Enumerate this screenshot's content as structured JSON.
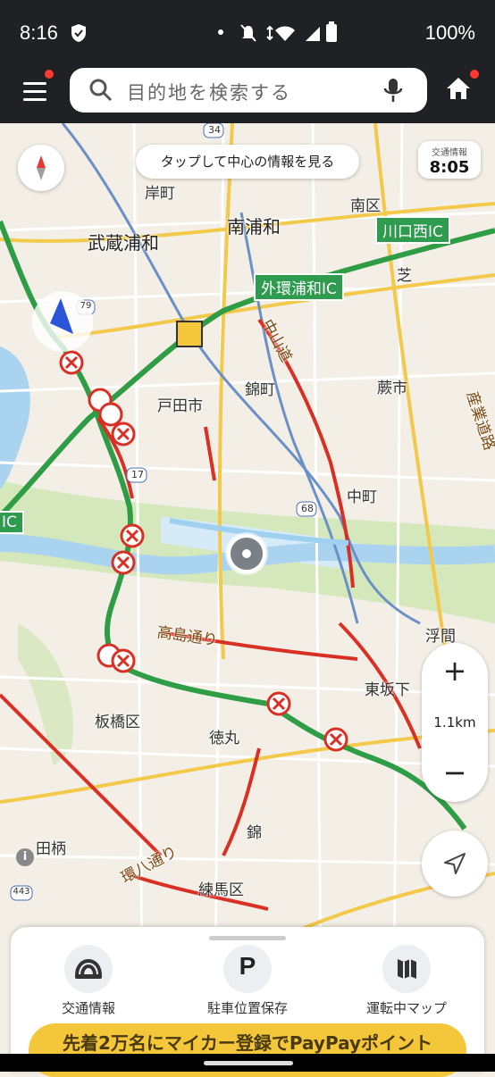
{
  "status_bar": {
    "time": "8:16",
    "battery": "100%"
  },
  "search": {
    "placeholder": "目的地を検索する"
  },
  "map": {
    "center_info_label": "タップして中心の情報を見る",
    "traffic_info": {
      "label": "交通情報",
      "time": "8:05"
    },
    "zoom": {
      "plus": "+",
      "minus": "−",
      "scale": "1.1km"
    },
    "labels": [
      "岸町",
      "武蔵浦和",
      "南浦和",
      "南区",
      "戸田市",
      "錦町",
      "蕨市",
      "中町",
      "浮間",
      "東坂下",
      "板橋区",
      "徳丸",
      "錦",
      "練馬区",
      "田柄",
      "高島通り",
      "環八通り",
      "中山道",
      "芝",
      "産業道路"
    ],
    "ic_labels": [
      "川口西IC",
      "外環浦和IC",
      "IC"
    ],
    "route_numbers": [
      "34",
      "17",
      "68",
      "443",
      "79"
    ]
  },
  "bottom_sheet": {
    "buttons": [
      {
        "label": "交通情報",
        "icon": "traffic-icon"
      },
      {
        "label": "駐車位置保存",
        "icon": "parking-icon"
      },
      {
        "label": "運転中マップ",
        "icon": "map-icon"
      }
    ],
    "promo": "先着2万名にマイカー登録でPayPayポイント"
  },
  "colors": {
    "accent": "#ff3b30",
    "highway": "#2e9b4e",
    "congestion": "#d93025",
    "promo": "#f4c63a"
  }
}
